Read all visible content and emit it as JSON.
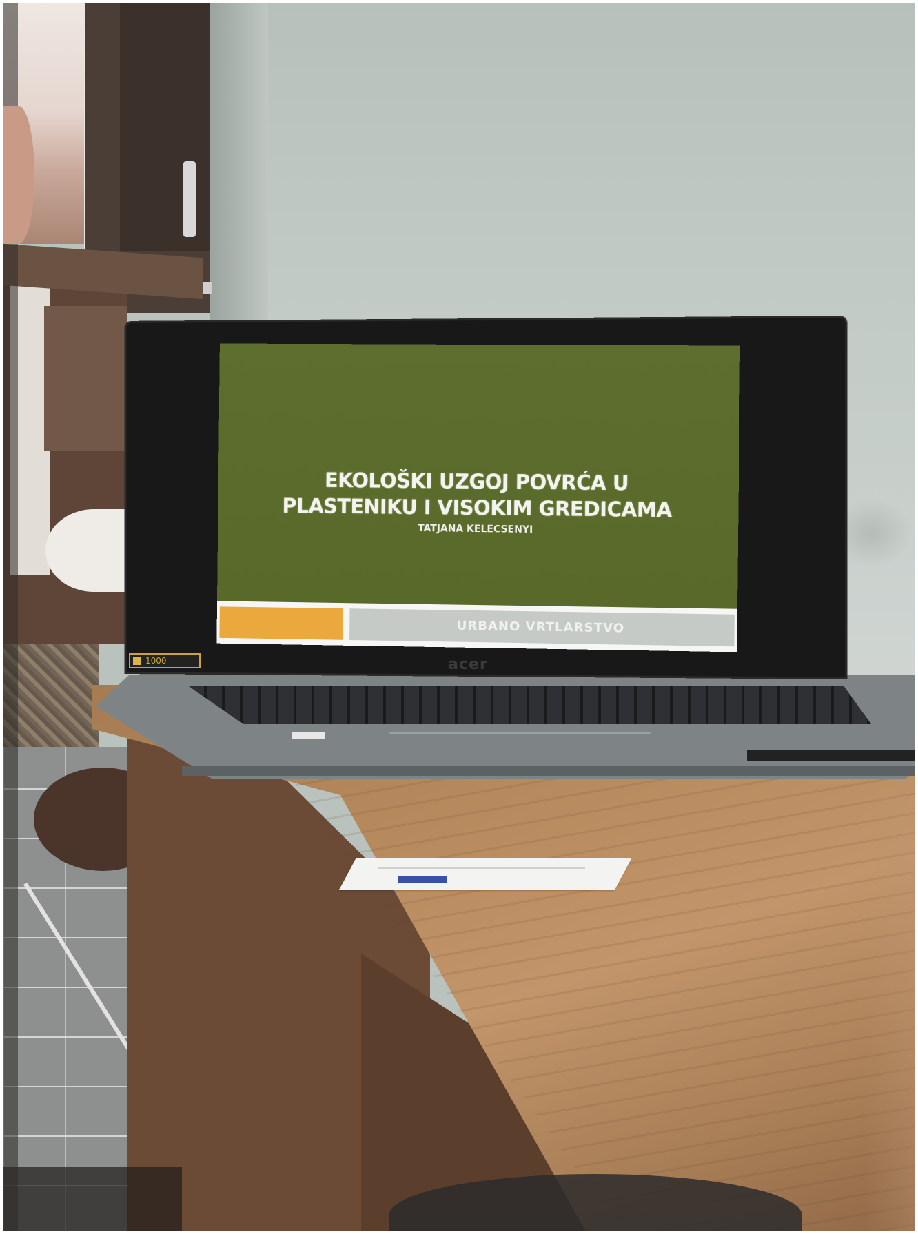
{
  "slide": {
    "title_line1": "EKOLOŠKI UZGOJ POVRĆA U",
    "title_line2": "PLASTENIKU I VISOKIM GREDICAMA",
    "author": "TATJANA KELECSENYI",
    "footer": "URBANO VRTLARSTVO",
    "colors": {
      "background": "#5a6b2c",
      "accent": "#eaa83d",
      "footer_bar": "#c5cac7"
    }
  },
  "laptop": {
    "brand": "acer",
    "sticker": "1000"
  }
}
